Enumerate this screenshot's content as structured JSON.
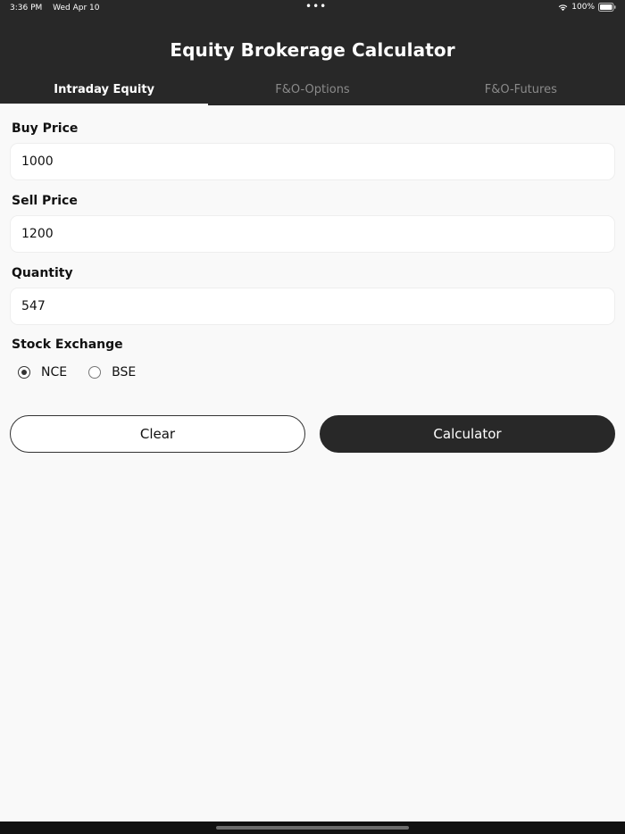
{
  "status": {
    "time": "3:36 PM",
    "date": "Wed Apr 10",
    "dots": "•••",
    "battery": "100%"
  },
  "app": {
    "title": "Equity Brokerage Calculator"
  },
  "tabs": [
    {
      "label": "Intraday Equity",
      "active": true
    },
    {
      "label": "F&O-Options",
      "active": false
    },
    {
      "label": "F&O-Futures",
      "active": false
    }
  ],
  "form": {
    "buy_price": {
      "label": "Buy Price",
      "value": "1000"
    },
    "sell_price": {
      "label": "Sell Price",
      "value": "1200"
    },
    "quantity": {
      "label": "Quantity",
      "value": "547"
    },
    "exchange": {
      "label": "Stock Exchange",
      "options": [
        {
          "label": "NCE",
          "selected": true
        },
        {
          "label": "BSE",
          "selected": false
        }
      ]
    }
  },
  "buttons": {
    "clear_label": "Clear",
    "calc_label": "Calculator"
  },
  "colors": {
    "header_bg": "#282828",
    "page_bg": "#f9f9f9",
    "accent": "#282828"
  }
}
